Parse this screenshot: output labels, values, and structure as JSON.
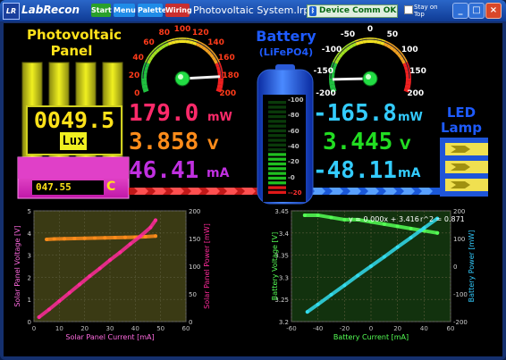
{
  "titlebar": {
    "app_name": "LabRecon",
    "logo_text": "LR",
    "buttons": {
      "start": "Start",
      "menu": "Menu",
      "palette": "Palette",
      "wiring": "Wiring"
    },
    "file_name": "Photovoltaic System.lrp",
    "comm_status": "Device Comm OK",
    "stay_on_top": "Stay on Top",
    "window_buttons": {
      "minimize": "_",
      "maximize": "□",
      "close": "×"
    }
  },
  "solar": {
    "title_line1": "Photovoltaic",
    "title_line2": "Panel",
    "lux_value": "0049.5",
    "lux_unit": "Lux",
    "temp_value": "047.55",
    "temp_unit": "C",
    "gauge_ticks": [
      "0",
      "20",
      "40",
      "60",
      "80",
      "100",
      "120",
      "140",
      "160",
      "180",
      "200"
    ],
    "gauge_value": 179.0,
    "power_value": "179.0",
    "power_unit": "mW",
    "voltage_value": "3.858",
    "voltage_unit": "V",
    "current_value": "46.41",
    "current_unit": "mA"
  },
  "battery": {
    "title_line1": "Battery",
    "title_line2": "(LiFePO4)",
    "level_ticks": [
      "100",
      "80",
      "60",
      "40",
      "20",
      "0",
      "-20"
    ],
    "gauge_ticks": [
      "-200",
      "-150",
      "-100",
      "-50",
      "0",
      "50",
      "100",
      "150",
      "200"
    ],
    "gauge_value": -165.8,
    "power_value": "-165.8",
    "power_unit": "mW",
    "voltage_value": "3.445",
    "voltage_unit": "V",
    "current_value": "-48.11",
    "current_unit": "mA"
  },
  "lamp": {
    "title_line1": "LED",
    "title_line2": "Lamp"
  },
  "colors": {
    "solar_power": "#ff2a6a",
    "solar_voltage": "#ff8c1a",
    "solar_current": "#c030e0",
    "battery_power": "#33ccff",
    "battery_voltage": "#22dd22",
    "battery_current": "#33ccff",
    "solar_title": "#ffe21a",
    "battery_title": "#1e5bff"
  },
  "chart_data": [
    {
      "type": "scatter",
      "xlabel": "Solar Panel Current [mA]",
      "ylabel": "Solar Panel Voltage [V]",
      "y2label": "Solar Panel Power [mW]",
      "xlim": [
        0,
        60
      ],
      "ylim": [
        0,
        5
      ],
      "y2lim": [
        0,
        200
      ],
      "x_ticks": [
        "0",
        "10",
        "20",
        "30",
        "40",
        "50",
        "60"
      ],
      "y_ticks": [
        "0",
        "1",
        "2",
        "3",
        "4",
        "5"
      ],
      "y2_ticks": [
        "0",
        "50",
        "100",
        "150",
        "200"
      ],
      "series": [
        {
          "name": "voltage",
          "axis": "left",
          "color": "#ff8c1a",
          "x": [
            5,
            8,
            12,
            16,
            20,
            24,
            28,
            32,
            36,
            40,
            44,
            48
          ],
          "y": [
            3.71,
            3.73,
            3.74,
            3.75,
            3.76,
            3.77,
            3.78,
            3.79,
            3.8,
            3.81,
            3.83,
            3.86
          ]
        },
        {
          "name": "power",
          "axis": "right",
          "color": "#ff2a9a",
          "x": [
            2,
            6,
            10,
            14,
            18,
            22,
            26,
            30,
            34,
            38,
            42,
            46,
            48
          ],
          "y": [
            8,
            22,
            37,
            52,
            67,
            82,
            96,
            111,
            125,
            140,
            154,
            170,
            183
          ]
        }
      ]
    },
    {
      "type": "scatter",
      "xlabel": "Battery Current [mA]",
      "ylabel": "Battery Voltage [V]",
      "y2label": "Battery Power [mW]",
      "annotation_fit": "y = 0.000x + 3.416",
      "annotation_r2": "r^2 = 0.871",
      "xlim": [
        -60,
        60
      ],
      "ylim": [
        3.2,
        3.45
      ],
      "y2lim": [
        -200,
        200
      ],
      "x_ticks": [
        "-60",
        "-40",
        "-20",
        "0",
        "20",
        "40",
        "60"
      ],
      "y_ticks": [
        "3.2",
        "3.25",
        "3.3",
        "3.35",
        "3.4",
        "3.45"
      ],
      "y2_ticks": [
        "-200",
        "-100",
        "0",
        "100",
        "200"
      ],
      "series": [
        {
          "name": "voltage",
          "axis": "left",
          "color": "#55ff55",
          "x": [
            -50,
            -40,
            -30,
            -20,
            -10,
            0,
            10,
            20,
            30,
            40,
            50
          ],
          "y": [
            3.44,
            3.44,
            3.435,
            3.43,
            3.43,
            3.425,
            3.42,
            3.415,
            3.41,
            3.405,
            3.4
          ]
        },
        {
          "name": "power",
          "axis": "right",
          "color": "#33ddee",
          "x": [
            -48,
            -40,
            -30,
            -20,
            -10,
            0,
            10,
            20,
            30,
            40,
            50
          ],
          "y": [
            -165,
            -138,
            -103,
            -69,
            -34,
            0,
            34,
            69,
            103,
            138,
            172
          ]
        }
      ]
    }
  ]
}
